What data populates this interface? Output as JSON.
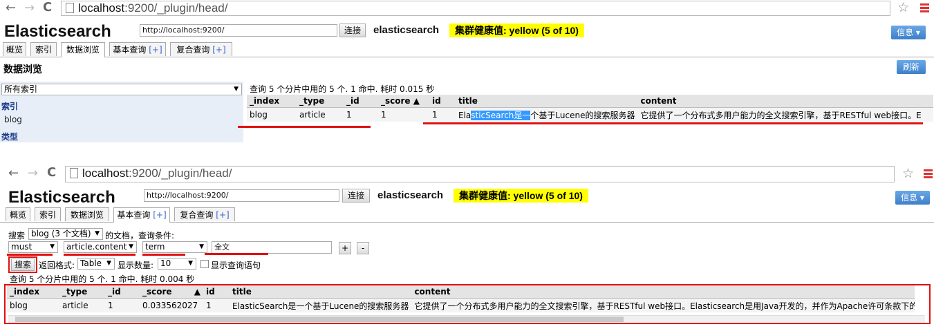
{
  "top": {
    "browser": {
      "url_host": "localhost",
      "url_rest": ":9200/_plugin/head/"
    },
    "app": {
      "brand": "Elasticsearch",
      "server_url": "http://localhost:9200/",
      "connect": "连接",
      "cluster_name": "elasticsearch",
      "health": "集群健康值: yellow (5 of 10)",
      "info": "信息 ▾",
      "tabs": [
        {
          "label": "概览",
          "plus": ""
        },
        {
          "label": "索引",
          "plus": ""
        },
        {
          "label": "数据浏览",
          "plus": ""
        },
        {
          "label": "基本查询 ",
          "plus": "[+]"
        },
        {
          "label": "复合查询 ",
          "plus": "[+]"
        }
      ],
      "active_tab": "数据浏览"
    },
    "section_title": "数据浏览",
    "refresh": "刷新",
    "index_select": "所有索引",
    "sidebar": {
      "index_header": "索引",
      "index_item": "blog",
      "type_header": "类型"
    },
    "summary": "查询 5 个分片中用的 5 个. 1 命中. 耗时 0.015 秒",
    "table": {
      "headers": [
        "_index",
        "_type",
        "_id",
        "_score ▲",
        "id",
        "title",
        "content"
      ],
      "row": [
        "blog",
        "article",
        "1",
        "1",
        "1"
      ],
      "title_pre": "Ela",
      "title_sel": "sticSearch是一",
      "title_post": "个基于Lucene的搜索服务器",
      "content": "它提供了一个分布式多用户能力的全文搜索引擎，基于RESTful web接口。E"
    }
  },
  "bottom": {
    "browser": {
      "url_host": "localhost",
      "url_rest": ":9200/_plugin/head/"
    },
    "app": {
      "brand": "Elasticsearch",
      "server_url": "http://localhost:9200/",
      "connect": "连接",
      "cluster_name": "elasticsearch",
      "health": "集群健康值: yellow (5 of 10)",
      "info": "信息 ▾",
      "tabs": [
        {
          "label": "概览",
          "plus": ""
        },
        {
          "label": "索引",
          "plus": ""
        },
        {
          "label": "数据浏览",
          "plus": ""
        },
        {
          "label": "基本查询 ",
          "plus": "[+]"
        },
        {
          "label": "复合查询 ",
          "plus": "[+]"
        }
      ],
      "active_tab": "基本查询"
    },
    "query": {
      "search_label": "搜索",
      "index_option": "blog (3 个文档)",
      "docs_label": "的文档，查询条件:",
      "bool": "must",
      "field": "article.content",
      "op": "term",
      "value": "全文",
      "add": "+",
      "remove": "-",
      "search_button": "搜索",
      "format_label": "返回格式:",
      "format": "Table",
      "count_label": "显示数量:",
      "count": "10",
      "show_query": "显示查询语句"
    },
    "summary": "查询 5 个分片中用的 5 个. 1 命中. 耗时 0.004 秒",
    "table": {
      "headers": [
        "_index",
        "_type",
        "_id",
        "_score",
        "id",
        "title",
        "content"
      ],
      "score_arrow": "▲",
      "row": [
        "blog",
        "article",
        "1",
        "0.033562027",
        "1",
        "ElasticSearch是一个基于Lucene的搜索服务器",
        "它提供了一个分布式多用户能力的全文搜索引擎，基于RESTful web接口。Elasticsearch是用Java开发的，并作为Apache许可条款下的开"
      ]
    }
  },
  "colors": {
    "annotation": "#e01010",
    "health_bg": "#ffff00",
    "info_bg": "#3d7fc9",
    "selection": "#3399ff"
  }
}
